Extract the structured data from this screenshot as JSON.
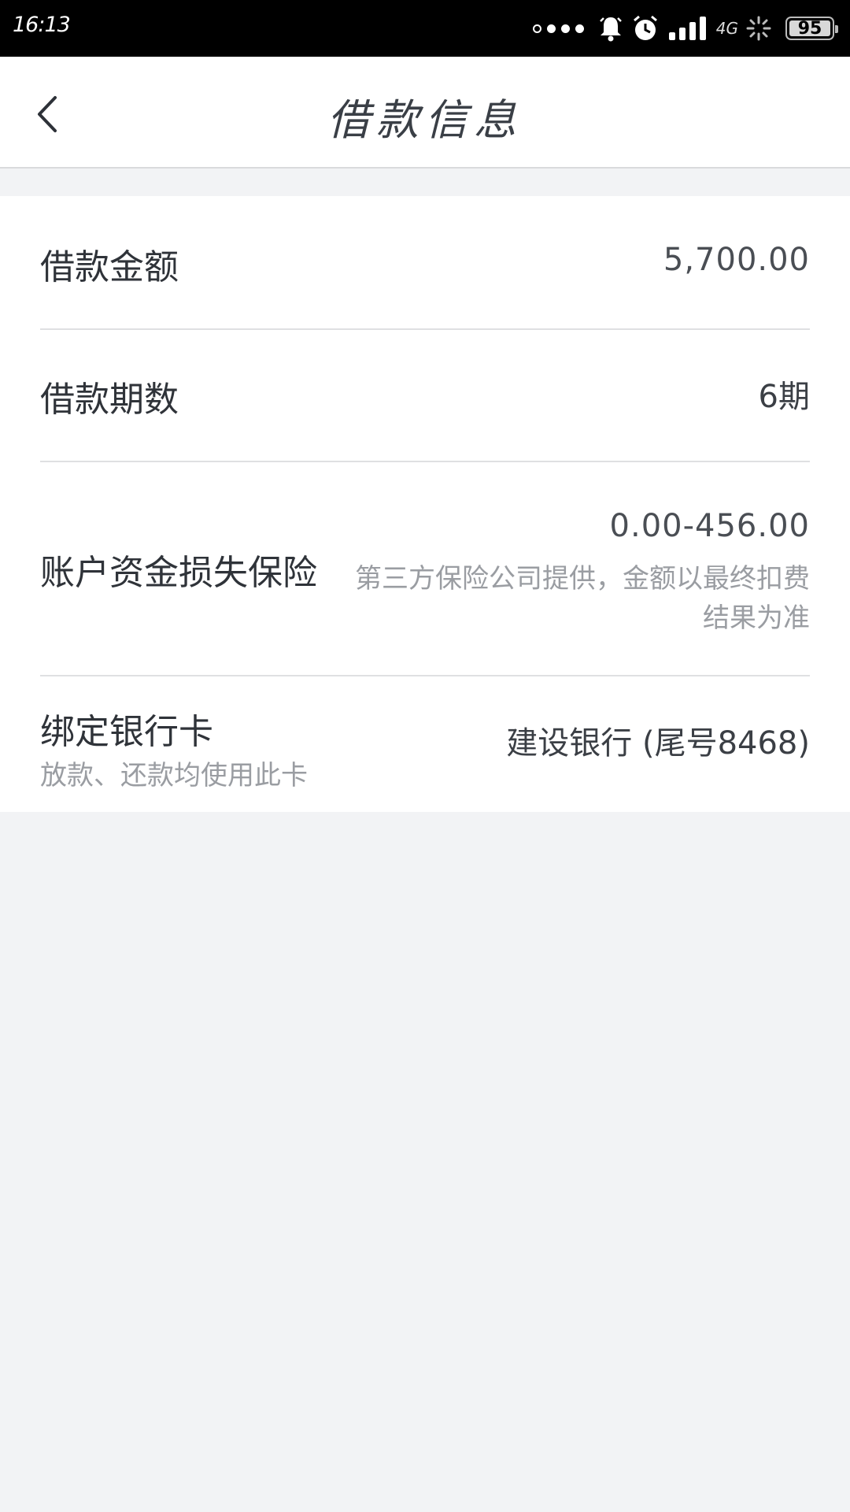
{
  "status_bar": {
    "time": "16:13",
    "network": "4G",
    "battery": "95"
  },
  "nav": {
    "title": "借款信息"
  },
  "rows": {
    "amount": {
      "label": "借款金额",
      "value": "5,700.00"
    },
    "periods": {
      "label": "借款期数",
      "value": "6期"
    },
    "insurance": {
      "label": "账户资金损失保险",
      "value": "0.00-456.00",
      "note_line1": "第三方保险公司提供，金额以最终扣费",
      "note_line2": "结果为准"
    },
    "bank_card": {
      "label": "绑定银行卡",
      "sub_label": "放款、还款均使用此卡",
      "value": "建设银行 (尾号8468)"
    }
  },
  "icons": {
    "back": "chevron-left-icon",
    "bell": "bell-icon",
    "alarm": "alarm-icon",
    "signal": "signal-icon",
    "loading": "loading-icon",
    "battery": "battery-icon"
  }
}
